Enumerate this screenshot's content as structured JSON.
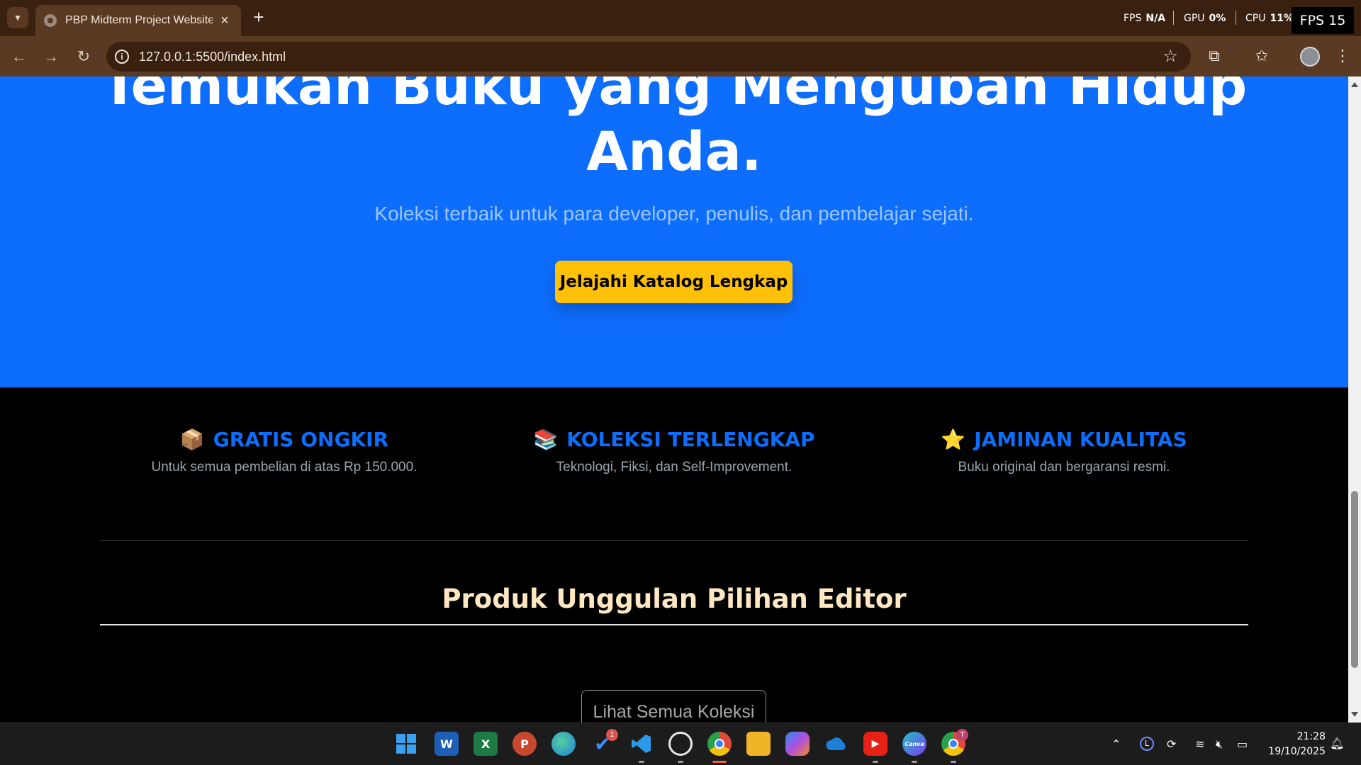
{
  "browser": {
    "tab_title": "PBP Midterm Project Website: T",
    "url": "127.0.0.1:5500/index.html",
    "perf": {
      "fps_label": "FPS",
      "fps_value": "N/A",
      "gpu_label": "GPU",
      "gpu_value": "0%",
      "cpu_label": "CPU",
      "cpu_value": "11%",
      "fps_badge": "FPS 15"
    }
  },
  "hero": {
    "title_line1": "Temukan Buku yang Mengubah Hidup",
    "title_line2": "Anda.",
    "subtitle": "Koleksi terbaik untuk para developer, penulis, dan pembelajar sejati.",
    "cta_label": "Jelajahi Katalog Lengkap",
    "bg_color": "#0d6efd",
    "cta_color": "#ffc107"
  },
  "features": [
    {
      "icon": "📦",
      "icon_name": "package-icon",
      "title": "GRATIS ONGKIR",
      "desc": "Untuk semua pembelian di atas Rp 150.000."
    },
    {
      "icon": "📚",
      "icon_name": "books-icon",
      "title": "KOLEKSI TERLENGKAP",
      "desc": "Teknologi, Fiksi, dan Self-Improvement."
    },
    {
      "icon": "⭐",
      "icon_name": "star-icon",
      "title": "JAMINAN KUALITAS",
      "desc": "Buku original dan bergaransi resmi."
    }
  ],
  "featured_section": {
    "title": "Produk Unggulan Pilihan Editor",
    "button_label": "Lihat Semua Koleksi"
  },
  "taskbar": {
    "apps": [
      {
        "name": "windows-start-icon",
        "label": ""
      },
      {
        "name": "word-icon",
        "label": "W"
      },
      {
        "name": "excel-icon",
        "label": "X"
      },
      {
        "name": "powerpoint-icon",
        "label": "P"
      },
      {
        "name": "edge-icon",
        "label": ""
      },
      {
        "name": "todo-icon",
        "label": "✔",
        "badge": "1"
      },
      {
        "name": "vscode-icon",
        "label": ""
      },
      {
        "name": "github-icon",
        "label": ""
      },
      {
        "name": "chrome-icon",
        "label": ""
      },
      {
        "name": "file-explorer-icon",
        "label": ""
      },
      {
        "name": "copilot-icon",
        "label": ""
      },
      {
        "name": "onedrive-icon",
        "label": ""
      },
      {
        "name": "youtube-icon",
        "label": "▶"
      },
      {
        "name": "canva-icon",
        "label": "Canva"
      },
      {
        "name": "chrome-profile-icon",
        "label": "",
        "badge": "T"
      }
    ],
    "clock_time": "21:28",
    "clock_date": "19/10/2025"
  }
}
